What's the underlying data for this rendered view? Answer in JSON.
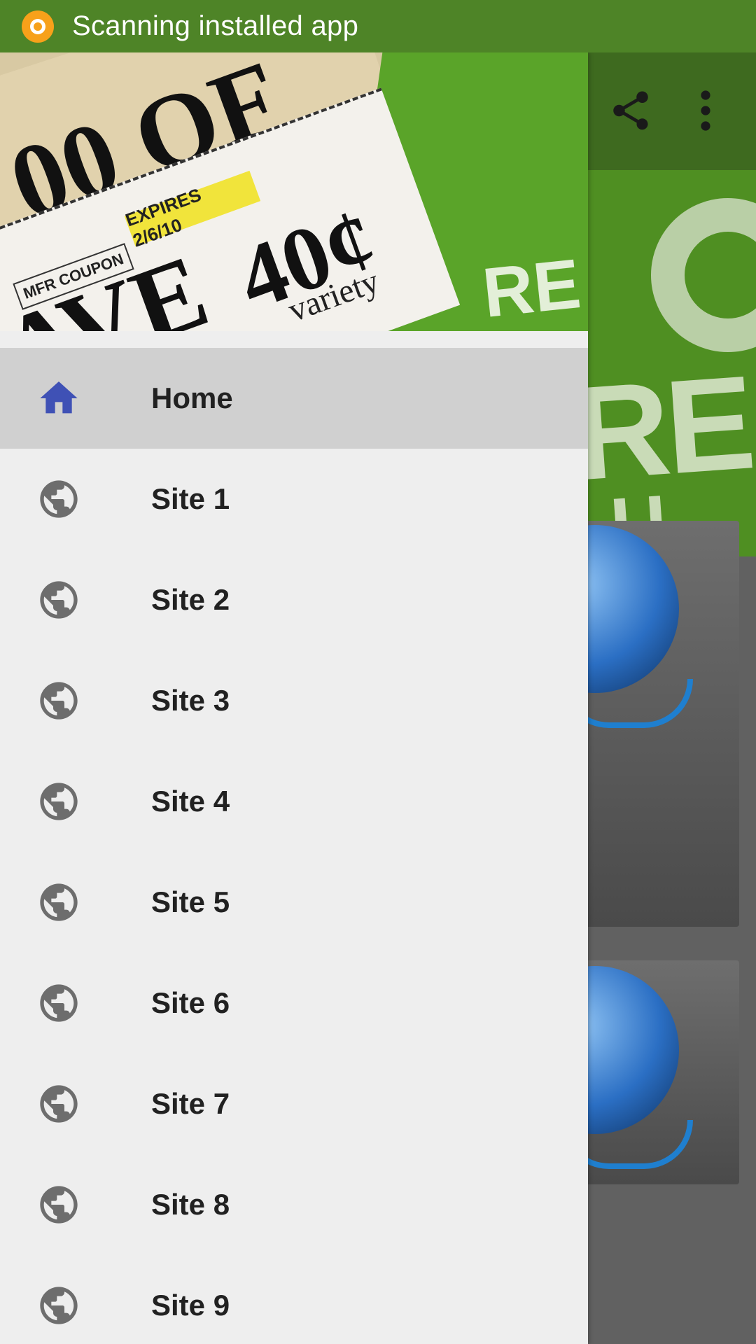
{
  "status_bar": {
    "notification_text": "Scanning installed app",
    "color": "#4e8427"
  },
  "toolbar": {
    "color": "#3e6a1f",
    "icons": [
      "share-icon",
      "more-vert-icon"
    ]
  },
  "drawer": {
    "header_image": {
      "coupon_price": "40¢",
      "coupon_save": "AVE",
      "expires_label": "EXPIRES 2/6/10",
      "mfr_label": "MFR COUPON",
      "variety_text": "variety",
      "top_text": "00 OF"
    },
    "menu": [
      {
        "label": "Home",
        "icon": "home-icon",
        "selected": true
      },
      {
        "label": "Site 1",
        "icon": "globe-icon",
        "selected": false
      },
      {
        "label": "Site 2",
        "icon": "globe-icon",
        "selected": false
      },
      {
        "label": "Site 3",
        "icon": "globe-icon",
        "selected": false
      },
      {
        "label": "Site 4",
        "icon": "globe-icon",
        "selected": false
      },
      {
        "label": "Site 5",
        "icon": "globe-icon",
        "selected": false
      },
      {
        "label": "Site 6",
        "icon": "globe-icon",
        "selected": false
      },
      {
        "label": "Site 7",
        "icon": "globe-icon",
        "selected": false
      },
      {
        "label": "Site 8",
        "icon": "globe-icon",
        "selected": false
      },
      {
        "label": "Site 9",
        "icon": "globe-icon",
        "selected": false
      }
    ],
    "home_icon_color": "#3f51b5",
    "globe_icon_color": "#6d6d6d",
    "selected_bg": "#d0d0d0",
    "background": "#eeeeee"
  },
  "background_banner": {
    "letters_large": "RE",
    "letters_small": "LU-RA"
  }
}
